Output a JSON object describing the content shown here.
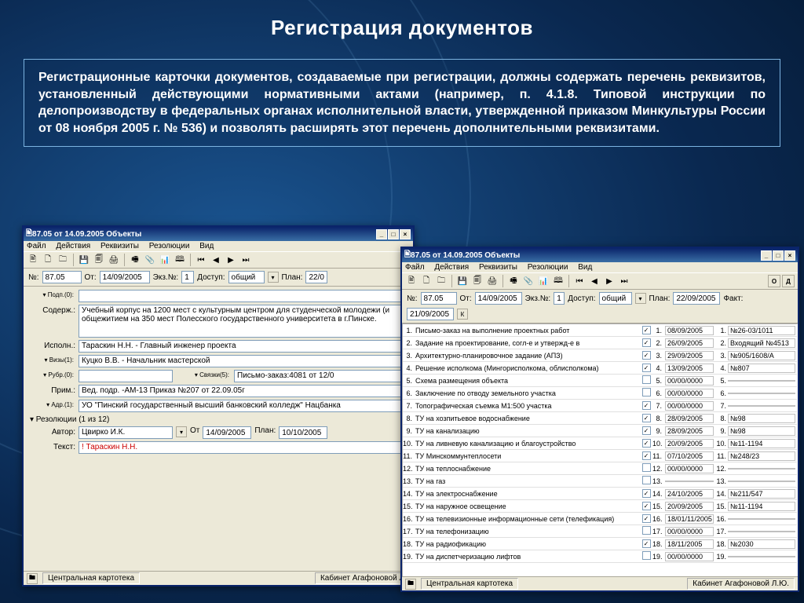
{
  "slide": {
    "title": "Регистрация документов",
    "body": "Регистрационные карточки документов, создаваемые при регистрации, должны содержать перечень реквизитов, установленный действующими нормативными актами (например, п. 4.1.8. Типовой инструкции по делопроизводству в федеральных органах исполнительной власти, утвержденной приказом Минкультуры России от 08 ноября 2005 г. № 536) и позволять расширять этот перечень дополнительными реквизитами."
  },
  "menu": {
    "m1": "Файл",
    "m2": "Действия",
    "m3": "Реквизиты",
    "m4": "Резолюции",
    "m5": "Вид"
  },
  "toolbar_glyphs": [
    "🖹",
    "🗋",
    "🗀",
    "💾",
    "🗐",
    "🖨",
    "🖷",
    "📎",
    "📊",
    "🕮",
    "⏮",
    "◀",
    "▶",
    "⏭"
  ],
  "win1": {
    "title": "87.05 от 14.09.2005 Объекты",
    "hdr": {
      "no_l": "№:",
      "no": "87.05",
      "ot_l": "От:",
      "ot": "14/09/2005",
      "ekz_l": "Экз.№:",
      "ekz": "1",
      "dost_l": "Доступ:",
      "dost": "общий",
      "plan_l": "План:",
      "plan": "22/0"
    },
    "rows": {
      "podl_l": "▾ Подп.(0):",
      "podl": "",
      "sod_l": "Содерж.:",
      "sod": "Учебный корпус на 1200 мест с культурным центром для студенческой молодежи (и общежитием на 350 мест  Полесского государственного университета в г.Пинске.",
      "isp_l": "Исполн.:",
      "isp": "Тараскин Н.Н. - Главный инженер проекта",
      "viz_l": "▾ Визы(1):",
      "viz": "Куцко В.В. - Начальник мастерской",
      "rub_l": "▾ Рубр.(0):",
      "rub": "",
      "svz_l": "▾ Связки(5):",
      "svz": "Письмо-заказ:4081 от 12/0",
      "prim_l": "Прим.:",
      "prim": "Вед. подр. -АМ-13 Приказ №207 от 22.09.05г",
      "adr_l": "▾ Адр.(1):",
      "adr": "УО \"Пинский государственный высший банковский колледж\" Нацбанка",
      "reso_l": "▾ Резолюции (1 из 12)",
      "avt_l": "Автор:",
      "avt": "Цвирко И.К.",
      "res_ot_l": "От",
      "res_ot": "14/09/2005",
      "res_plan_l": "План:",
      "res_plan": "10/10/2005",
      "txt_l": "Текст:",
      "txt": "!  Тараскин Н.Н."
    },
    "status": {
      "left": "Центральная картотека",
      "right": "Кабинет Агафоновой Л"
    }
  },
  "win2": {
    "title": "87.05 от 14.09.2005 Объекты",
    "hdr": {
      "no_l": "№:",
      "no": "87.05",
      "ot_l": "От:",
      "ot": "14/09/2005",
      "ekz_l": "Экз.№:",
      "ekz": "1",
      "dost_l": "Доступ:",
      "dost": "общий",
      "plan_l": "План:",
      "plan": "22/09/2005",
      "fakt_l": "Факт:",
      "fakt": "21/09/2005",
      "o": "О",
      "d": "Д",
      "k": "К"
    },
    "grid": [
      {
        "n": "1.",
        "name": "Письмо-заказ на выполнение проектных работ",
        "c": true,
        "nn": "1.",
        "d": "08/09/2005",
        "no": "№26-03/1011"
      },
      {
        "n": "2.",
        "name": "Задание на проектирование, согл-е и утвержд-е в",
        "c": true,
        "nn": "2.",
        "d": "26/09/2005",
        "no": "Входящий №4513"
      },
      {
        "n": "3.",
        "name": "Архитектурно-планировочное задание (АПЗ)",
        "c": true,
        "nn": "3.",
        "d": "29/09/2005",
        "no": "№905/1608/А"
      },
      {
        "n": "4.",
        "name": "Решение исполкома (Мингорисполкома, облисполкома)",
        "c": true,
        "nn": "4.",
        "d": "13/09/2005",
        "no": "№807"
      },
      {
        "n": "5.",
        "name": "Схема размещения объекта",
        "c": false,
        "nn": "5.",
        "d": "00/00/0000",
        "no": ""
      },
      {
        "n": "6.",
        "name": "Заключение по отводу земельного участка",
        "c": false,
        "nn": "6.",
        "d": "00/00/0000",
        "no": ""
      },
      {
        "n": "7.",
        "name": "Топографическая съемка М1:500 участка",
        "c": true,
        "nn": "7.",
        "d": "00/00/0000",
        "no": ""
      },
      {
        "n": "8.",
        "name": "ТУ на хозпитьевое водоснабжение",
        "c": true,
        "nn": "8.",
        "d": "28/09/2005",
        "no": "№98"
      },
      {
        "n": "9.",
        "name": "ТУ на канализацию",
        "c": true,
        "nn": "9.",
        "d": "28/09/2005",
        "no": "№98"
      },
      {
        "n": "10.",
        "name": "ТУ на ливневую канализацию и благоустройство",
        "c": true,
        "nn": "10.",
        "d": "20/09/2005",
        "no": "№11-1194"
      },
      {
        "n": "11.",
        "name": "ТУ Минскоммунтеплосети",
        "c": true,
        "nn": "11.",
        "d": "07/10/2005",
        "no": "№248/23"
      },
      {
        "n": "12.",
        "name": "ТУ на теплоснабжение",
        "c": false,
        "nn": "12.",
        "d": "00/00/0000",
        "no": ""
      },
      {
        "n": "13.",
        "name": "ТУ на газ",
        "c": false,
        "nn": "13.",
        "d": "",
        "no": ""
      },
      {
        "n": "14.",
        "name": "ТУ на электроснабжение",
        "c": true,
        "nn": "14.",
        "d": "24/10/2005",
        "no": "№211/547"
      },
      {
        "n": "15.",
        "name": "ТУ на наружное освещение",
        "c": true,
        "nn": "15.",
        "d": "20/09/2005",
        "no": "№11-1194"
      },
      {
        "n": "16.",
        "name": "ТУ на телевизионные информационные сети (телефикация)",
        "c": true,
        "nn": "16.",
        "d": "18/01/11/2005",
        "no": ""
      },
      {
        "n": "17.",
        "name": "ТУ на телефонизацию",
        "c": false,
        "nn": "17.",
        "d": "00/00/0000",
        "no": ""
      },
      {
        "n": "18.",
        "name": "ТУ на радиофикацию",
        "c": true,
        "nn": "18.",
        "d": "18/11/2005",
        "no": "№2030"
      },
      {
        "n": "19.",
        "name": "ТУ на диспетчеризацию лифтов",
        "c": false,
        "nn": "19.",
        "d": "00/00/0000",
        "no": ""
      }
    ],
    "status": {
      "left": "Центральная картотека",
      "right": "Кабинет Агафоновой Л.Ю."
    }
  }
}
